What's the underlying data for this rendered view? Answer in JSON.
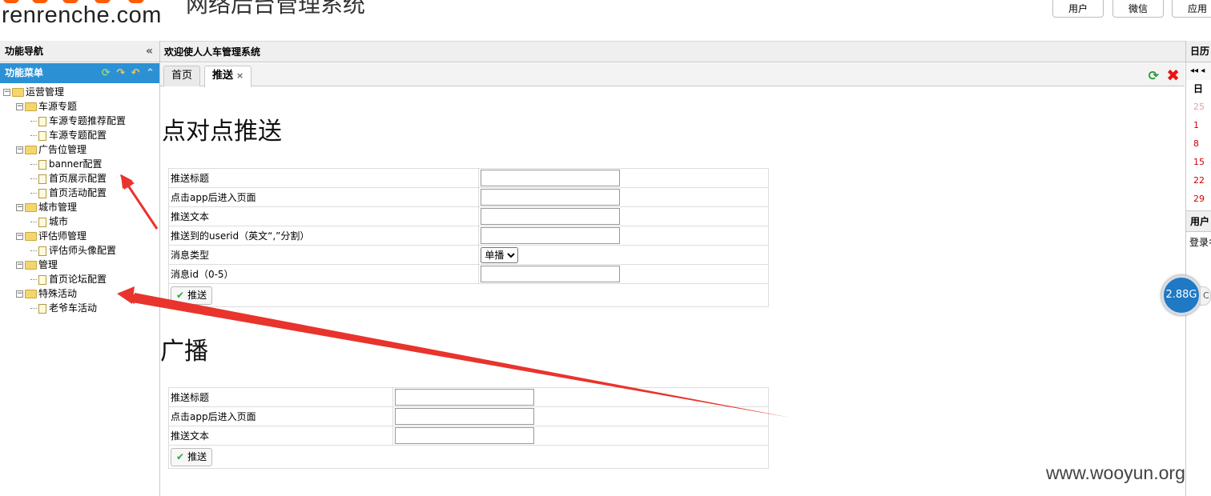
{
  "header": {
    "logo_text": "renrenche.com",
    "system_title": "网络后台管理系统",
    "buttons": [
      "用户",
      "微信",
      "应用"
    ]
  },
  "sidebar": {
    "title": "功能导航",
    "collapse_icon": "«",
    "menu_title": "功能菜单",
    "tree": [
      {
        "label": "运营管理",
        "level": 0,
        "type": "folder"
      },
      {
        "label": "车源专题",
        "level": 1,
        "type": "folder"
      },
      {
        "label": "车源专题推荐配置",
        "level": 2,
        "type": "doc"
      },
      {
        "label": "车源专题配置",
        "level": 2,
        "type": "doc"
      },
      {
        "label": "广告位管理",
        "level": 1,
        "type": "folder"
      },
      {
        "label": "banner配置",
        "level": 2,
        "type": "doc"
      },
      {
        "label": "首页展示配置",
        "level": 2,
        "type": "doc"
      },
      {
        "label": "首页活动配置",
        "level": 2,
        "type": "doc"
      },
      {
        "label": "城市管理",
        "level": 1,
        "type": "folder"
      },
      {
        "label": "城市",
        "level": 2,
        "type": "doc"
      },
      {
        "label": "评估师管理",
        "level": 1,
        "type": "folder"
      },
      {
        "label": "评估师头像配置",
        "level": 2,
        "type": "doc"
      },
      {
        "label": "管理",
        "level": 1,
        "type": "folder"
      },
      {
        "label": "首页论坛配置",
        "level": 2,
        "type": "doc"
      },
      {
        "label": "特殊活动",
        "level": 1,
        "type": "folder"
      },
      {
        "label": "老爷车活动",
        "level": 2,
        "type": "doc"
      }
    ]
  },
  "main": {
    "welcome": "欢迎使人人车管理系统",
    "tabs": [
      {
        "label": "首页",
        "active": false
      },
      {
        "label": "推送",
        "active": true,
        "close": "×"
      }
    ],
    "p2p": {
      "title": "点对点推送",
      "rows": [
        {
          "label": "推送标题",
          "field": "input",
          "value": ""
        },
        {
          "label": "点击app后进入页面",
          "field": "input",
          "value": ""
        },
        {
          "label": "推送文本",
          "field": "input",
          "value": ""
        },
        {
          "label": "推送到的userid（英文“,”分割）",
          "field": "input",
          "value": ""
        },
        {
          "label": "消息类型",
          "field": "select",
          "value": "单播"
        },
        {
          "label": "消息id（0-5）",
          "field": "input",
          "value": ""
        }
      ],
      "submit": "推送"
    },
    "broadcast": {
      "title": "广播",
      "rows": [
        {
          "label": "推送标题",
          "value": ""
        },
        {
          "label": "点击app后进入页面",
          "value": ""
        },
        {
          "label": "推送文本",
          "value": ""
        }
      ],
      "submit": "推送"
    }
  },
  "right_panel": {
    "calendar_title": "日历",
    "calendar_nav": "◂◂ ◂",
    "weekday": "日",
    "days": [
      "25",
      "1",
      "8",
      "15",
      "22",
      "29"
    ],
    "user_title": "用户",
    "login_text": "登录名"
  },
  "speed_ball": {
    "value": "2.88G"
  },
  "watermark": "www.wooyun.org",
  "colors": {
    "menu_head": "#2c91d4",
    "arrow": "#e8342c"
  }
}
